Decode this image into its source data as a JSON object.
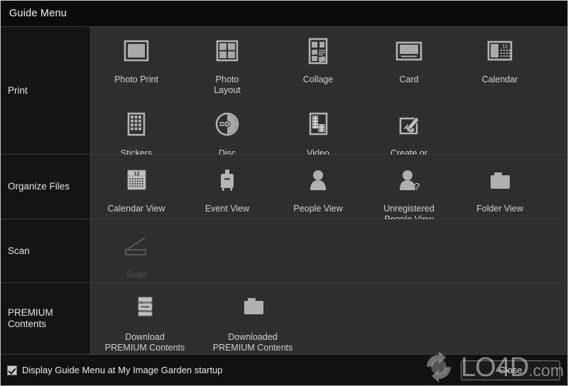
{
  "window": {
    "title": "Guide Menu"
  },
  "sections": [
    {
      "label": "Print",
      "rows": [
        [
          {
            "icon": "photo-print-icon",
            "label": "Photo Print"
          },
          {
            "icon": "photo-layout-icon",
            "label": "Photo\nLayout"
          },
          {
            "icon": "collage-icon",
            "label": "Collage"
          },
          {
            "icon": "card-icon",
            "label": "Card"
          },
          {
            "icon": "calendar-icon",
            "label": "Calendar"
          }
        ],
        [
          {
            "icon": "stickers-icon",
            "label": "Stickers"
          },
          {
            "icon": "disc-label-icon",
            "label": "Disc\nLabel"
          },
          {
            "icon": "video-layout-icon",
            "label": "Video\nLayout"
          },
          {
            "icon": "create-open-items-icon",
            "label": "Create or\nOpen Items"
          }
        ]
      ]
    },
    {
      "label": "Organize Files",
      "rows": [
        [
          {
            "icon": "calendar-view-icon",
            "label": "Calendar View"
          },
          {
            "icon": "event-view-icon",
            "label": "Event View"
          },
          {
            "icon": "people-view-icon",
            "label": "People View"
          },
          {
            "icon": "unregistered-people-view-icon",
            "label": "Unregistered\nPeople View"
          },
          {
            "icon": "folder-view-icon",
            "label": "Folder View"
          }
        ]
      ]
    },
    {
      "label": "Scan",
      "rows": [
        [
          {
            "icon": "scan-icon",
            "label": "Scan",
            "disabled": true
          }
        ]
      ]
    },
    {
      "label": "PREMIUM\nContents",
      "rows": [
        [
          {
            "icon": "creative-park-premium-icon",
            "label": "Download\nPREMIUM Contents"
          },
          {
            "icon": "downloaded-premium-folder-icon",
            "label": "Downloaded\nPREMIUM Contents"
          }
        ]
      ]
    }
  ],
  "premium_badge": {
    "line1": "CREATIVE",
    "line2": "PARK",
    "line3": "PREMIUM"
  },
  "calendar_number": "12",
  "footer": {
    "checkbox_label": "Display Guide Menu at My Image Garden startup",
    "checkbox_checked": true,
    "close_label": "Close"
  },
  "watermark": {
    "text": "LO4D",
    "domain": ".com"
  },
  "colors": {
    "window_bg": "#2e2e2e",
    "sidebar_bg": "#141414",
    "titlebar_bg": "#0b0b0b",
    "text": "#d2d2d2",
    "icon": "#b5b5b5",
    "disabled": "#555555"
  }
}
